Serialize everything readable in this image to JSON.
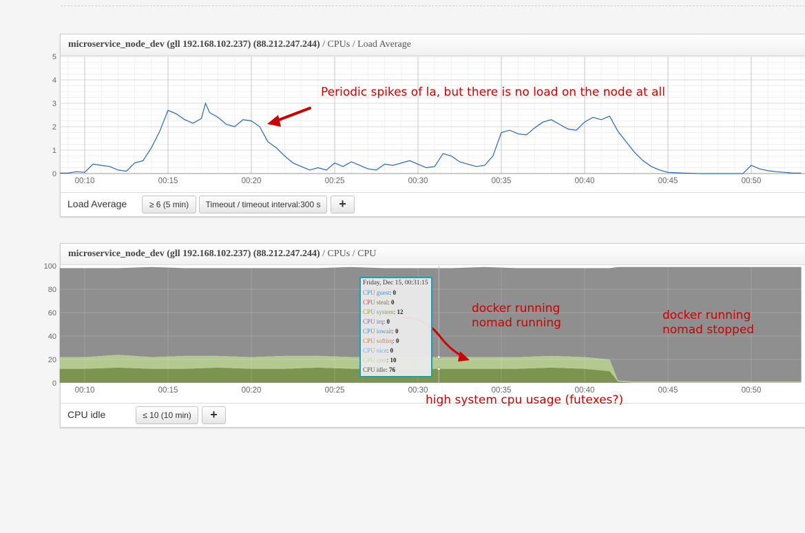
{
  "load_panel": {
    "title_bold": "microservice_node_dev (gll 192.168.102.237) (88.212.247.244)",
    "title_rest": " / CPUs / Load Average",
    "footer_label": "Load Average",
    "buttons": [
      "≥ 6 (5 min)",
      "Timeout / timeout interval:300 s",
      "+"
    ]
  },
  "cpu_panel": {
    "title_bold": "microservice_node_dev (gll 192.168.102.237) (88.212.247.244)",
    "title_rest": " / CPUs / CPU",
    "footer_label": "CPU idle",
    "buttons": [
      "≤ 10 (10 min)",
      "+"
    ]
  },
  "tooltip": {
    "date": "Friday, Dec 15, 00:31:15",
    "rows": [
      {
        "label": "CPU guest",
        "value": "0",
        "color": "#4f8fc0"
      },
      {
        "label": "CPU steal",
        "value": "0",
        "color": "#c0504d"
      },
      {
        "label": "CPU system",
        "value": "12",
        "color": "#8aa83c"
      },
      {
        "label": "CPU irq",
        "value": "0",
        "color": "#7a6fb0"
      },
      {
        "label": "CPU iowait",
        "value": "0",
        "color": "#3a9ec0"
      },
      {
        "label": "CPU softirq",
        "value": "0",
        "color": "#e07b39"
      },
      {
        "label": "CPU nice",
        "value": "0",
        "color": "#7fb2dd"
      },
      {
        "label": "CPU user",
        "value": "10",
        "color": "#c4d89a"
      },
      {
        "label": "CPU idle",
        "value": "76",
        "color": "#555555"
      }
    ]
  },
  "annotations": {
    "la_note": "Periodic spikes of la, but there is no load on the node at all",
    "docker_running_1": "docker running",
    "nomad_running": "nomad running",
    "docker_running_2": "docker running",
    "nomad_stopped": "nomad stopped",
    "high_system": "high system cpu usage (futexes?)"
  },
  "colors": {
    "annotation": "#cc0000",
    "load_line": "#2266bb",
    "cpu_user": "#b3c98f",
    "cpu_system": "#7b9550",
    "cpu_idle": "#8f8f8f",
    "tooltip_border": "#1a9fb5"
  },
  "chart_data": [
    {
      "type": "line",
      "title": "Load Average",
      "x": [
        "00:08:30",
        "00:09",
        "00:09:30",
        "00:10",
        "00:10:30",
        "00:11",
        "00:11:30",
        "00:12",
        "00:12:30",
        "00:13",
        "00:13:30",
        "00:14",
        "00:14:30",
        "00:15",
        "00:15:30",
        "00:16",
        "00:16:30",
        "00:17",
        "00:17:15",
        "00:17:30",
        "00:18",
        "00:18:30",
        "00:19",
        "00:19:30",
        "00:20",
        "00:20:30",
        "00:21",
        "00:21:30",
        "00:22",
        "00:22:30",
        "00:23",
        "00:23:30",
        "00:24",
        "00:24:30",
        "00:25",
        "00:25:30",
        "00:26",
        "00:26:30",
        "00:27",
        "00:27:30",
        "00:28",
        "00:28:30",
        "00:29",
        "00:29:30",
        "00:30",
        "00:30:30",
        "00:31",
        "00:31:30",
        "00:32",
        "00:32:30",
        "00:33",
        "00:33:30",
        "00:34",
        "00:34:30",
        "00:35",
        "00:35:30",
        "00:36",
        "00:36:30",
        "00:37",
        "00:37:30",
        "00:38",
        "00:38:30",
        "00:39",
        "00:39:30",
        "00:40",
        "00:40:30",
        "00:41",
        "00:41:30",
        "00:42",
        "00:42:30",
        "00:43",
        "00:43:30",
        "00:44",
        "00:44:30",
        "00:45",
        "00:46",
        "00:47",
        "00:48",
        "00:49",
        "00:49:30",
        "00:50",
        "00:50:30",
        "00:51",
        "00:51:30",
        "00:52",
        "00:52:30",
        "00:53"
      ],
      "values": [
        0.02,
        0.02,
        0.08,
        0.05,
        0.4,
        0.35,
        0.3,
        0.15,
        0.1,
        0.45,
        0.55,
        1.1,
        1.8,
        2.7,
        2.55,
        2.3,
        2.15,
        2.35,
        3.0,
        2.6,
        2.4,
        2.1,
        2.0,
        2.3,
        2.25,
        2.0,
        1.35,
        1.1,
        0.75,
        0.45,
        0.3,
        0.15,
        0.25,
        0.15,
        0.45,
        0.3,
        0.5,
        0.35,
        0.2,
        0.15,
        0.4,
        0.35,
        0.45,
        0.55,
        0.4,
        0.25,
        0.3,
        0.85,
        0.75,
        0.5,
        0.4,
        0.3,
        0.35,
        0.75,
        1.75,
        1.85,
        1.7,
        1.65,
        1.95,
        2.2,
        2.3,
        2.1,
        1.9,
        1.85,
        2.2,
        2.4,
        2.3,
        2.45,
        1.8,
        1.35,
        0.9,
        0.55,
        0.3,
        0.15,
        0.05,
        0.02,
        0.0,
        0.0,
        0.0,
        0.0,
        0.35,
        0.2,
        0.12,
        0.08,
        0.05,
        0.02,
        0.02
      ],
      "x_ticks": [
        "00:10",
        "00:15",
        "00:20",
        "00:25",
        "00:30",
        "00:35",
        "00:40",
        "00:45",
        "00:50"
      ],
      "y_ticks": [
        0,
        1,
        2,
        3,
        4,
        5
      ],
      "ylim": [
        0,
        5
      ],
      "grid": true
    },
    {
      "type": "area",
      "title": "CPU",
      "x_ticks": [
        "00:10",
        "00:15",
        "00:20",
        "00:25",
        "00:30",
        "00:35",
        "00:40",
        "00:45",
        "00:50"
      ],
      "y_ticks": [
        0,
        20,
        40,
        60,
        80,
        100
      ],
      "ylim": [
        0,
        100
      ],
      "x": [
        "00:08:30",
        "00:10",
        "00:12",
        "00:14",
        "00:16",
        "00:18",
        "00:20",
        "00:22",
        "00:24",
        "00:26",
        "00:28",
        "00:30",
        "00:32",
        "00:34",
        "00:36",
        "00:38",
        "00:40",
        "00:41:30",
        "00:42",
        "00:43",
        "00:44",
        "00:46",
        "00:48",
        "00:50",
        "00:52",
        "00:53"
      ],
      "series": [
        {
          "name": "CPU system",
          "values": [
            12,
            12,
            13,
            12,
            12,
            13,
            12,
            12,
            13,
            12,
            12,
            12,
            12,
            12,
            12,
            13,
            12,
            10,
            1,
            0,
            0,
            0,
            0,
            0,
            0,
            0
          ]
        },
        {
          "name": "CPU user",
          "values": [
            10,
            10,
            11,
            10,
            11,
            10,
            10,
            11,
            10,
            10,
            10,
            10,
            10,
            10,
            10,
            10,
            10,
            10,
            1,
            1,
            1,
            1,
            1,
            1,
            1,
            1
          ]
        },
        {
          "name": "CPU idle",
          "values": [
            76,
            76,
            74,
            77,
            75,
            75,
            76,
            75,
            75,
            77,
            76,
            76,
            76,
            77,
            76,
            75,
            76,
            78,
            97,
            98,
            98,
            98,
            98,
            98,
            98,
            98
          ]
        }
      ],
      "grid": true
    }
  ]
}
